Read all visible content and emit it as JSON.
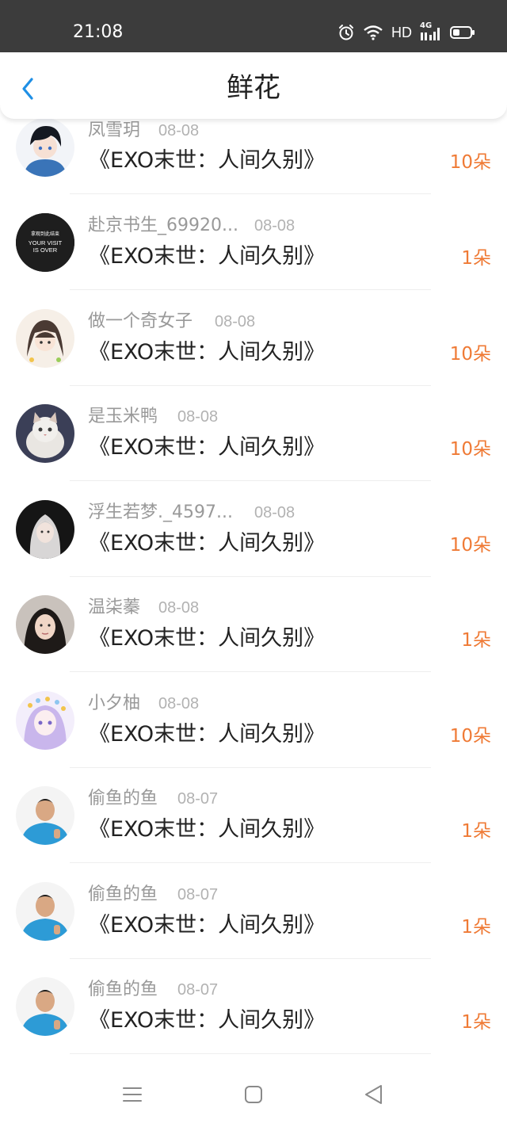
{
  "status_bar": {
    "time": "21:08",
    "network_label": "HD",
    "signal_label": "4G",
    "icons": [
      "alarm-icon",
      "wifi-icon",
      "signal-icon",
      "battery-icon"
    ]
  },
  "header": {
    "title": "鲜花",
    "back_icon": "chevron-left-icon"
  },
  "colors": {
    "accent_blue": "#1f8fe5",
    "count_orange": "#ef7a35",
    "status_bar_bg": "#3c3c3c"
  },
  "items": [
    {
      "username": "凤雪玥",
      "date": "08-08",
      "book": "《EXO末世：人间久别》",
      "count": "10朵"
    },
    {
      "username": "赴京书生_69920...",
      "date": "08-08",
      "book": "《EXO末世：人间久别》",
      "count": "1朵",
      "avatar_text_1": "拿观到此结束",
      "avatar_text_2": "YOUR VISIT",
      "avatar_text_3": "IS OVER"
    },
    {
      "username": "做一个奇女子",
      "date": "08-08",
      "book": "《EXO末世：人间久别》",
      "count": "10朵"
    },
    {
      "username": "是玉米鸭",
      "date": "08-08",
      "book": "《EXO末世：人间久别》",
      "count": "10朵"
    },
    {
      "username": "浮生若梦._4597...",
      "date": "08-08",
      "book": "《EXO末世：人间久别》",
      "count": "10朵"
    },
    {
      "username": "温柒蓁",
      "date": "08-08",
      "book": "《EXO末世：人间久别》",
      "count": "1朵"
    },
    {
      "username": "小夕柚",
      "date": "08-08",
      "book": "《EXO末世：人间久别》",
      "count": "10朵"
    },
    {
      "username": "偷鱼的鱼",
      "date": "08-07",
      "book": "《EXO末世：人间久别》",
      "count": "1朵"
    },
    {
      "username": "偷鱼的鱼",
      "date": "08-07",
      "book": "《EXO末世：人间久别》",
      "count": "1朵"
    },
    {
      "username": "偷鱼的鱼",
      "date": "08-07",
      "book": "《EXO末世：人间久别》",
      "count": "1朵"
    }
  ],
  "bottom_nav": {
    "icons": [
      "menu-icon",
      "home-square-icon",
      "back-triangle-icon"
    ]
  }
}
